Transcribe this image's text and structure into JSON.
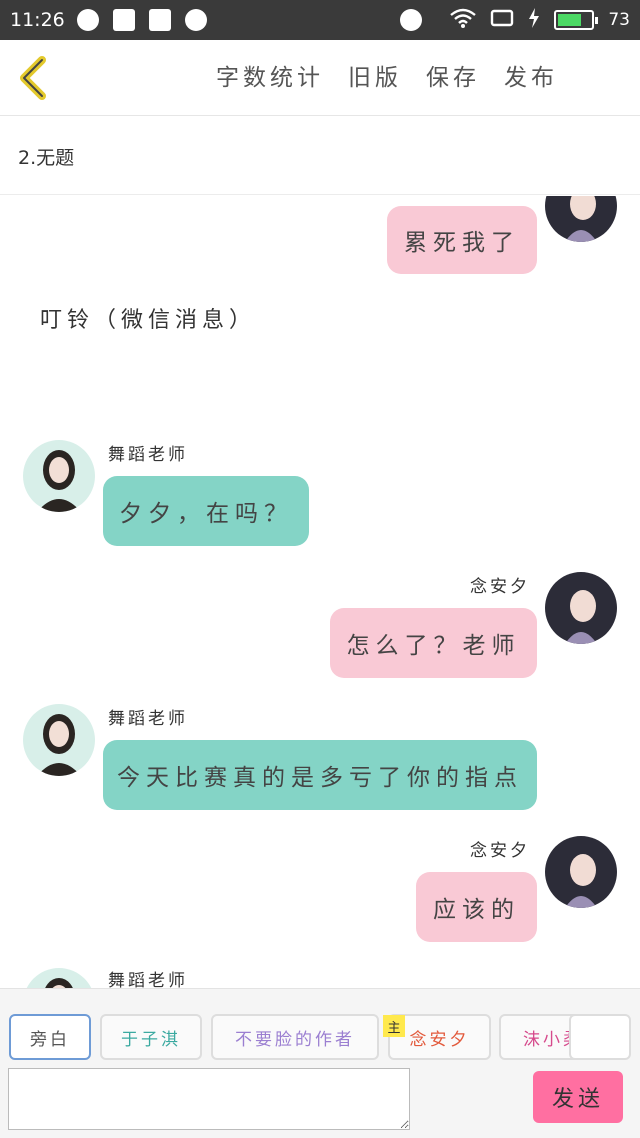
{
  "status_bar": {
    "time": "11:26",
    "battery": "73",
    "battery_level": 0.73
  },
  "nav": {
    "word_count": "字数统计",
    "old_version": "旧版",
    "save": "保存",
    "publish": "发布"
  },
  "chapter": {
    "title": "2.无题"
  },
  "messages": [
    {
      "sender": "",
      "side": "right",
      "text": "累死我了"
    },
    {
      "narration": "叮铃（微信消息）"
    },
    {
      "sender": "舞蹈老师",
      "side": "left",
      "text": "夕夕，在吗？"
    },
    {
      "sender": "念安夕",
      "side": "right",
      "text": "怎么了？老师"
    },
    {
      "sender": "舞蹈老师",
      "side": "left",
      "text": "今天比赛真的是多亏了你的指点"
    },
    {
      "sender": "念安夕",
      "side": "right",
      "text": "应该的"
    },
    {
      "sender": "舞蹈老师",
      "side": "left",
      "text": ""
    }
  ],
  "characters": [
    {
      "label": "旁白",
      "color": "#555555"
    },
    {
      "label": "于子淇",
      "color": "#3aa9a0"
    },
    {
      "label": "不要脸的作者",
      "color": "#9b7fd1"
    },
    {
      "label": "念安夕",
      "color": "#e25a3c",
      "tag": "主"
    },
    {
      "label": "沫小柔",
      "color": "#d64a8c"
    }
  ],
  "composer": {
    "placeholder": "",
    "send_label": "发送"
  },
  "colors": {
    "pink_bubble": "#f9c9d5",
    "teal_bubble": "#84d4c6",
    "send_button": "#ff6fa1"
  }
}
